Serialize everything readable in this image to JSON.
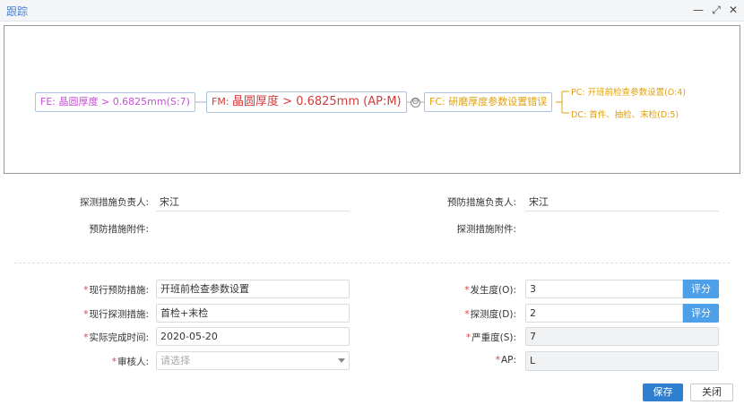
{
  "window": {
    "title": "跟踪"
  },
  "diagram": {
    "fe": "FE: 晶圆厚度 > 0.6825mm(S:7)",
    "fm_prefix": "FM: ",
    "fm_text": "晶圆厚度 > 0.6825mm (AP:M)",
    "fc": "FC: 研磨厚度参数设置错误",
    "collapse_symbol": "⊖",
    "pc": "PC: 开班前检查参数设置(O:4)",
    "dc": "DC: 首件、抽检、末检(D:5)"
  },
  "responsible": {
    "detect_owner_label": "探测措施负责人:",
    "detect_owner_value": "宋江",
    "prevent_owner_label": "预防措施负责人:",
    "prevent_owner_value": "宋江",
    "prevent_attachment_label": "预防措施附件:",
    "detect_attachment_label": "探测措施附件:"
  },
  "form": {
    "required_mark": "*",
    "current_prevention_label": "现行预防措施:",
    "current_prevention_value": "开班前检查参数设置",
    "current_detection_label": "现行探测措施:",
    "current_detection_value": "首检+末检",
    "completion_time_label": "实际完成时间:",
    "completion_time_value": "2020-05-20",
    "reviewer_label": "审核人:",
    "reviewer_placeholder": "请选择",
    "occurrence_label": "发生度(O):",
    "occurrence_value": "3",
    "detection_label": "探测度(D):",
    "detection_value": "2",
    "severity_label": "严重度(S):",
    "severity_value": "7",
    "ap_label": "AP:",
    "ap_value": "L",
    "score_button": "评分"
  },
  "actions": {
    "save": "保存",
    "close": "关闭"
  },
  "colors": {
    "title": "#4a7fd4",
    "fe": "#c74fd6",
    "fm": "#d63a3a",
    "fc": "#e0a010",
    "score_button": "#4d9fe8",
    "save_button": "#2f7fd1"
  }
}
